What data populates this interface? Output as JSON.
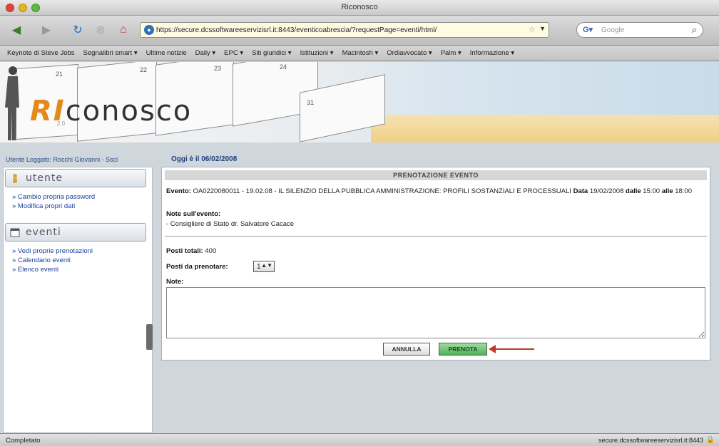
{
  "window": {
    "title": "Riconosco"
  },
  "toolbar": {
    "url": "https://secure.dcssoftwareeservizisrl.it:8443/eventicoabrescia/?requestPage=eventi/html/",
    "search_placeholder": "Google"
  },
  "bookmarks": [
    "Keynote di Steve Jobs",
    "Segnalibri smart ▾",
    "Ultime notizie",
    "Daily ▾",
    "EPC ▾",
    "Siti giuridici ▾",
    "Istituzioni ▾",
    "Macintosh ▾",
    "Ordiavvocato ▾",
    "Palm ▾",
    "Informazione ▾"
  ],
  "banner": {
    "logo_ri": "RI",
    "logo_rest": "conosco",
    "logo_sub": "2.0",
    "calendar_numbers": [
      "21",
      "22",
      "23",
      "24",
      "31"
    ]
  },
  "info": {
    "user_logged": "Utente Loggato: Rocchi Giovanni - Ssci",
    "today": "Oggi è il 06/02/2008"
  },
  "sidebar": {
    "section_user": "utente",
    "user_links": [
      "» Cambio propria password",
      "» Modifica propri dati"
    ],
    "section_events": "eventi",
    "event_links": [
      "» Vedi proprie prenotazioni",
      "» Calendario eventi",
      "» Elenco eventi"
    ]
  },
  "panel": {
    "heading": "PRENOTAZIONE EVENTO",
    "event_label": "Evento:",
    "event_value": "OA0220080011 - 19.02.08 - IL SILENZIO DELLA PUBBLICA AMMINISTRAZIONE: PROFILI SOSTANZIALI E PROCESSUALI",
    "date_label": "Data",
    "date_value": "19/02/2008",
    "from_label": "dalle",
    "from_value": "15:00",
    "to_label": "alle",
    "to_value": "18:00",
    "notes_event_label": "Note sull'evento:",
    "notes_event_value": "- Consigliere di Stato dr. Salvatore Cacace",
    "total_seats_label": "Posti totali:",
    "total_seats_value": "400",
    "seats_to_book_label": "Posti da prenotare:",
    "seats_to_book_value": "1",
    "notes_label": "Note:",
    "cancel_label": "ANNULLA",
    "book_label": "PRENOTA"
  },
  "status": {
    "left": "Completato",
    "right": "secure.dcssoftwareeservizisrl.it:8443"
  }
}
